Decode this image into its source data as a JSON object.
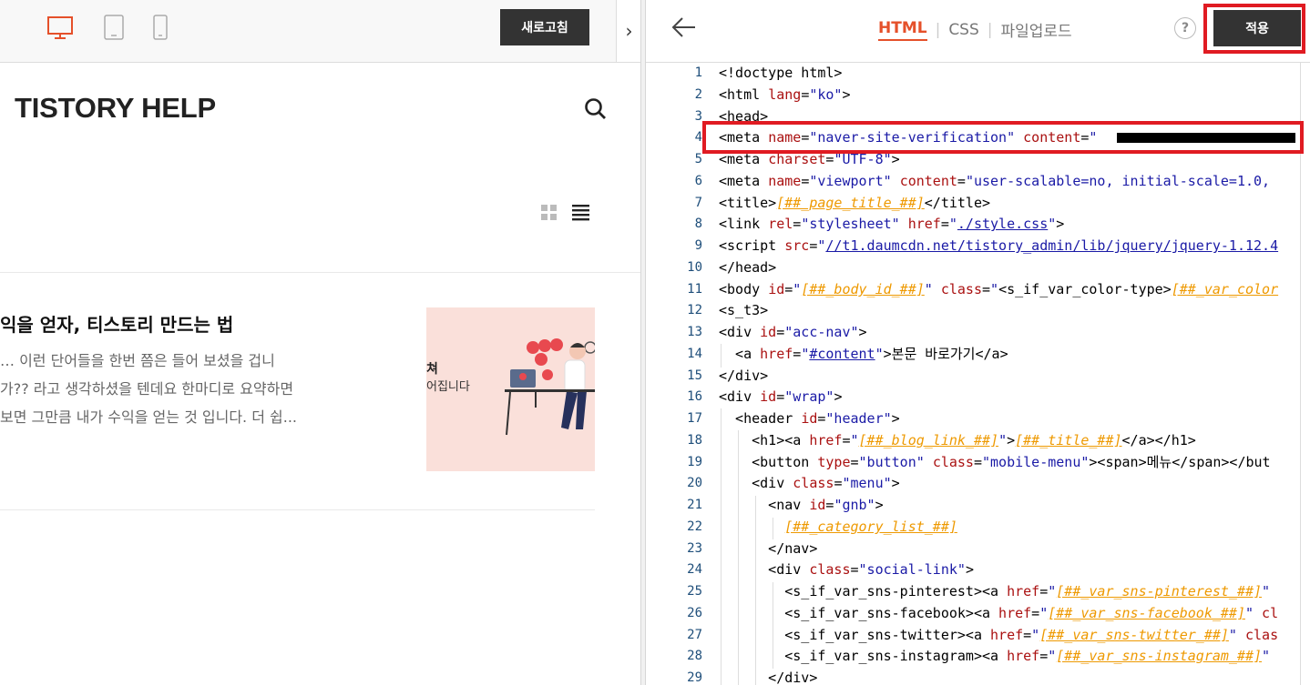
{
  "left_toolbar": {
    "devices": [
      "desktop-icon",
      "tablet-icon",
      "mobile-icon"
    ],
    "refresh_label": "새로고침",
    "toggle_label": "›"
  },
  "preview": {
    "blog_title": "TISTORY HELP",
    "post": {
      "title": "익을 얻자, 티스토리 만드는 법",
      "excerpt": [
        "… 이런 단어들을 한번 쯤은 들어 보셨을 겁니",
        "가?? 라고 생각하셨을 텐데요 한마디로 요약하면",
        "보면 그만큼 내가 수익을 얻는 것 입니다. 더 쉽..."
      ],
      "thumb_text_1": "쳐",
      "thumb_text_2": "어집니다"
    }
  },
  "right_toolbar": {
    "tabs": [
      {
        "label": "HTML",
        "active": true
      },
      {
        "label": "CSS",
        "active": false
      },
      {
        "label": "파일업로드",
        "active": false
      }
    ],
    "help_label": "?",
    "apply_label": "적용"
  },
  "editor": {
    "line_numbers": [
      "1",
      "2",
      "3",
      "4",
      "5",
      "6",
      "7",
      "8",
      "9",
      "10",
      "11",
      "12",
      "13",
      "14",
      "15",
      "16",
      "17",
      "18",
      "19",
      "20",
      "21",
      "22",
      "23",
      "24",
      "25",
      "26",
      "27",
      "28",
      "29"
    ]
  },
  "colors": {
    "accent": "#e5502a",
    "highlight": "#e01b22",
    "button_dark": "#333333",
    "template_var": "#ee9900"
  }
}
